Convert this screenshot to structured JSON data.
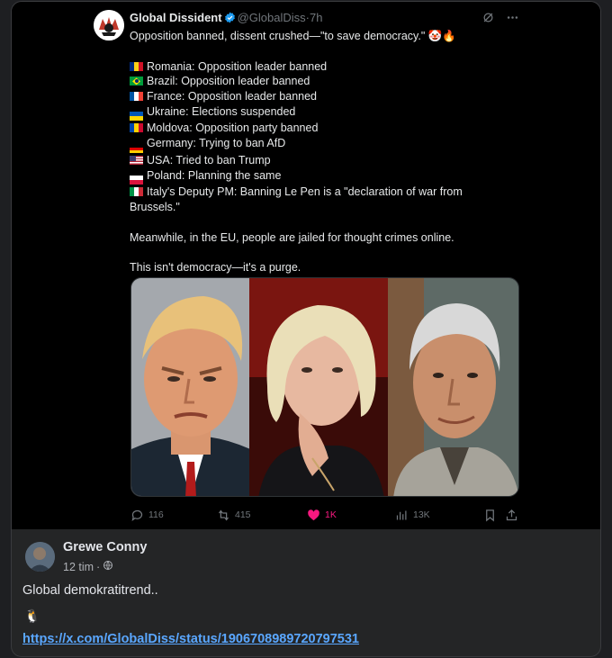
{
  "tweet": {
    "display_name": "Global Dissident",
    "handle": "@GlobalDiss",
    "separator": "·",
    "time": "7h",
    "lines": [
      {
        "text": "Opposition banned, dissent crushed—\"to save democracy.\" 🤡🔥",
        "flag": null
      },
      {
        "text": "",
        "flag": null
      },
      {
        "text": "Romania: Opposition leader banned",
        "flag": "ro"
      },
      {
        "text": "Brazil: Opposition leader banned",
        "flag": "br"
      },
      {
        "text": "France: Opposition leader banned",
        "flag": "fr"
      },
      {
        "text": "Ukraine: Elections suspended",
        "flag": "ua"
      },
      {
        "text": "Moldova: Opposition party banned",
        "flag": "md"
      },
      {
        "text": "Germany: Trying to ban AfD",
        "flag": "de"
      },
      {
        "text": "USA: Tried to ban Trump",
        "flag": "us"
      },
      {
        "text": "Poland: Planning the same",
        "flag": "pl"
      },
      {
        "text": "Italy's Deputy PM: Banning Le Pen is a \"declaration of war from Brussels.\"",
        "flag": "it"
      },
      {
        "text": "",
        "flag": null
      },
      {
        "text": "Meanwhile, in the EU, people are jailed for thought crimes online.",
        "flag": null
      },
      {
        "text": "",
        "flag": null
      },
      {
        "text": "This isn't democracy—it's a purge.",
        "flag": null
      }
    ],
    "flag_colors": {
      "ro": [
        "#002b7f",
        "#fcd116",
        "#ce1126"
      ],
      "fr": [
        "#0055a4",
        "#ffffff",
        "#ef4135"
      ],
      "it": [
        "#009246",
        "#ffffff",
        "#ce2b37"
      ],
      "md": [
        "#0046ae",
        "#ffd200",
        "#cc092f"
      ],
      "de": [
        "#000000",
        "#dd0000",
        "#ffce00"
      ],
      "ua": [
        "#0057b7",
        "#ffd700"
      ],
      "pl": [
        "#ffffff",
        "#dc143c"
      ],
      "br": [
        "#009c3b",
        "#ffdf00",
        "#002776"
      ],
      "us": [
        "#b22234",
        "#ffffff",
        "#3c3b6e"
      ]
    },
    "stats": {
      "replies": "116",
      "reposts": "415",
      "likes": "1K",
      "views": "13K"
    }
  },
  "post": {
    "author": "Grewe Conny",
    "time": "12 tim",
    "separator": "·",
    "text": "Global demokratitrend..",
    "emoji": "🐧",
    "link": "https://x.com/GlobalDiss/status/1906708989720797531"
  },
  "colors": {
    "like_pink": "#f91880",
    "verified_blue": "#1d9bf0",
    "link_blue": "#5aa7ff"
  }
}
